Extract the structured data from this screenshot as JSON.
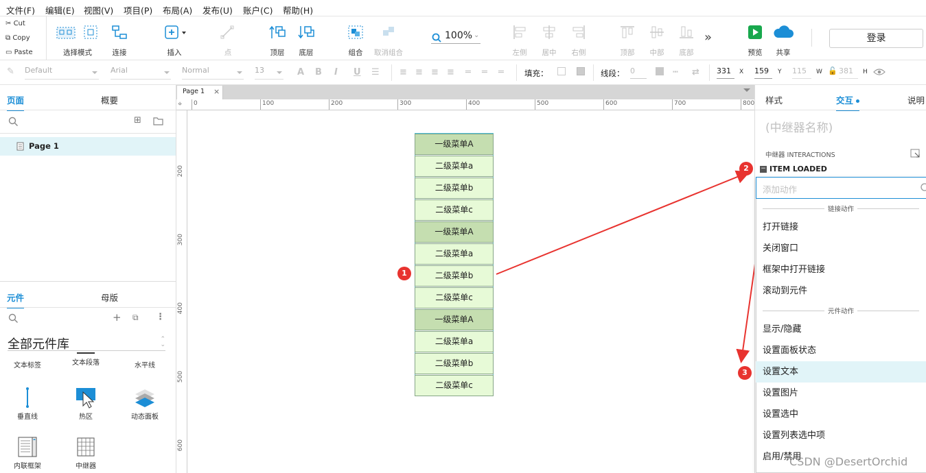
{
  "menubar": [
    "文件(F)",
    "编辑(E)",
    "视图(V)",
    "项目(P)",
    "布局(A)",
    "发布(U)",
    "账户(C)",
    "帮助(H)"
  ],
  "clipboard": {
    "cut": "Cut",
    "copy": "Copy",
    "paste": "Paste"
  },
  "toolbar": {
    "select_mode": "选择模式",
    "connect": "连接",
    "insert": "插入",
    "point": "点",
    "top": "顶层",
    "bottom": "底层",
    "group": "组合",
    "ungroup": "取消组合",
    "zoom": "100%",
    "align_left": "左侧",
    "align_center": "居中",
    "align_right": "右侧",
    "align_top": "顶部",
    "align_middle": "中部",
    "align_bottom": "底部",
    "more": "»",
    "preview": "预览",
    "share": "共享",
    "login": "登录"
  },
  "format": {
    "style": "Default",
    "font": "Arial",
    "weight": "Normal",
    "size": "13",
    "fill_label": "填充：",
    "line_label": "线段：",
    "line_width": "0",
    "x": "331",
    "x_label": "X",
    "y": "159",
    "y_label": "Y",
    "w": "115",
    "w_label": "W",
    "h": "381",
    "h_label": "H"
  },
  "left": {
    "tab_pages": "页面",
    "tab_outline": "概要",
    "page_item": "Page 1",
    "tab_widgets": "元件",
    "tab_masters": "母版",
    "library": "全部元件库",
    "widgets": [
      {
        "label": "文本标签",
        "icon": "text-label-icon"
      },
      {
        "label": "文本段落",
        "icon": "paragraph-icon"
      },
      {
        "label": "水平线",
        "icon": "horizontal-line-icon"
      },
      {
        "label": "垂直线",
        "icon": "vertical-line-icon"
      },
      {
        "label": "热区",
        "icon": "hotspot-icon"
      },
      {
        "label": "动态面板",
        "icon": "dynamic-panel-icon"
      },
      {
        "label": "内联框架",
        "icon": "inline-frame-icon"
      },
      {
        "label": "中继器",
        "icon": "repeater-icon"
      }
    ]
  },
  "canvas": {
    "tab": "Page 1",
    "hticks": [
      "0",
      "100",
      "200",
      "300",
      "400",
      "500",
      "600",
      "700",
      "800"
    ],
    "vticks": [
      "200",
      "300",
      "400",
      "500",
      "600"
    ],
    "items": [
      {
        "label": "一级菜单A",
        "level": 1
      },
      {
        "label": "二级菜单a",
        "level": 2
      },
      {
        "label": "二级菜单b",
        "level": 2
      },
      {
        "label": "二级菜单c",
        "level": 2
      },
      {
        "label": "一级菜单A",
        "level": 1
      },
      {
        "label": "二级菜单a",
        "level": 2
      },
      {
        "label": "二级菜单b",
        "level": 2
      },
      {
        "label": "二级菜单c",
        "level": 2
      },
      {
        "label": "一级菜单A",
        "level": 1
      },
      {
        "label": "二级菜单a",
        "level": 2
      },
      {
        "label": "二级菜单b",
        "level": 2
      },
      {
        "label": "二级菜单c",
        "level": 2
      }
    ]
  },
  "right": {
    "tab_style": "样式",
    "tab_interact": "交互",
    "tab_notes": "说明",
    "repeater_name": "(中继器名称)",
    "interactions_title": "中继器 INTERACTIONS",
    "event": "ITEM LOADED",
    "add_action_placeholder": "添加动作",
    "sections": {
      "link": "链接动作",
      "widget": "元件动作"
    },
    "link_actions": [
      "打开链接",
      "关闭窗口",
      "框架中打开链接",
      "滚动到元件"
    ],
    "widget_actions": [
      "显示/隐藏",
      "设置面板状态",
      "设置文本",
      "设置图片",
      "设置选中",
      "设置列表选中项",
      "启用/禁用"
    ]
  },
  "annotations": [
    "1",
    "2",
    "3"
  ],
  "watermark": "CSDN @DesertOrchid",
  "colors": {
    "accent": "#1c8ed6",
    "badge": "#e8332f",
    "level1": "#c5deb0",
    "level2": "#e7fad7",
    "highlight": "#e1f4f8"
  }
}
